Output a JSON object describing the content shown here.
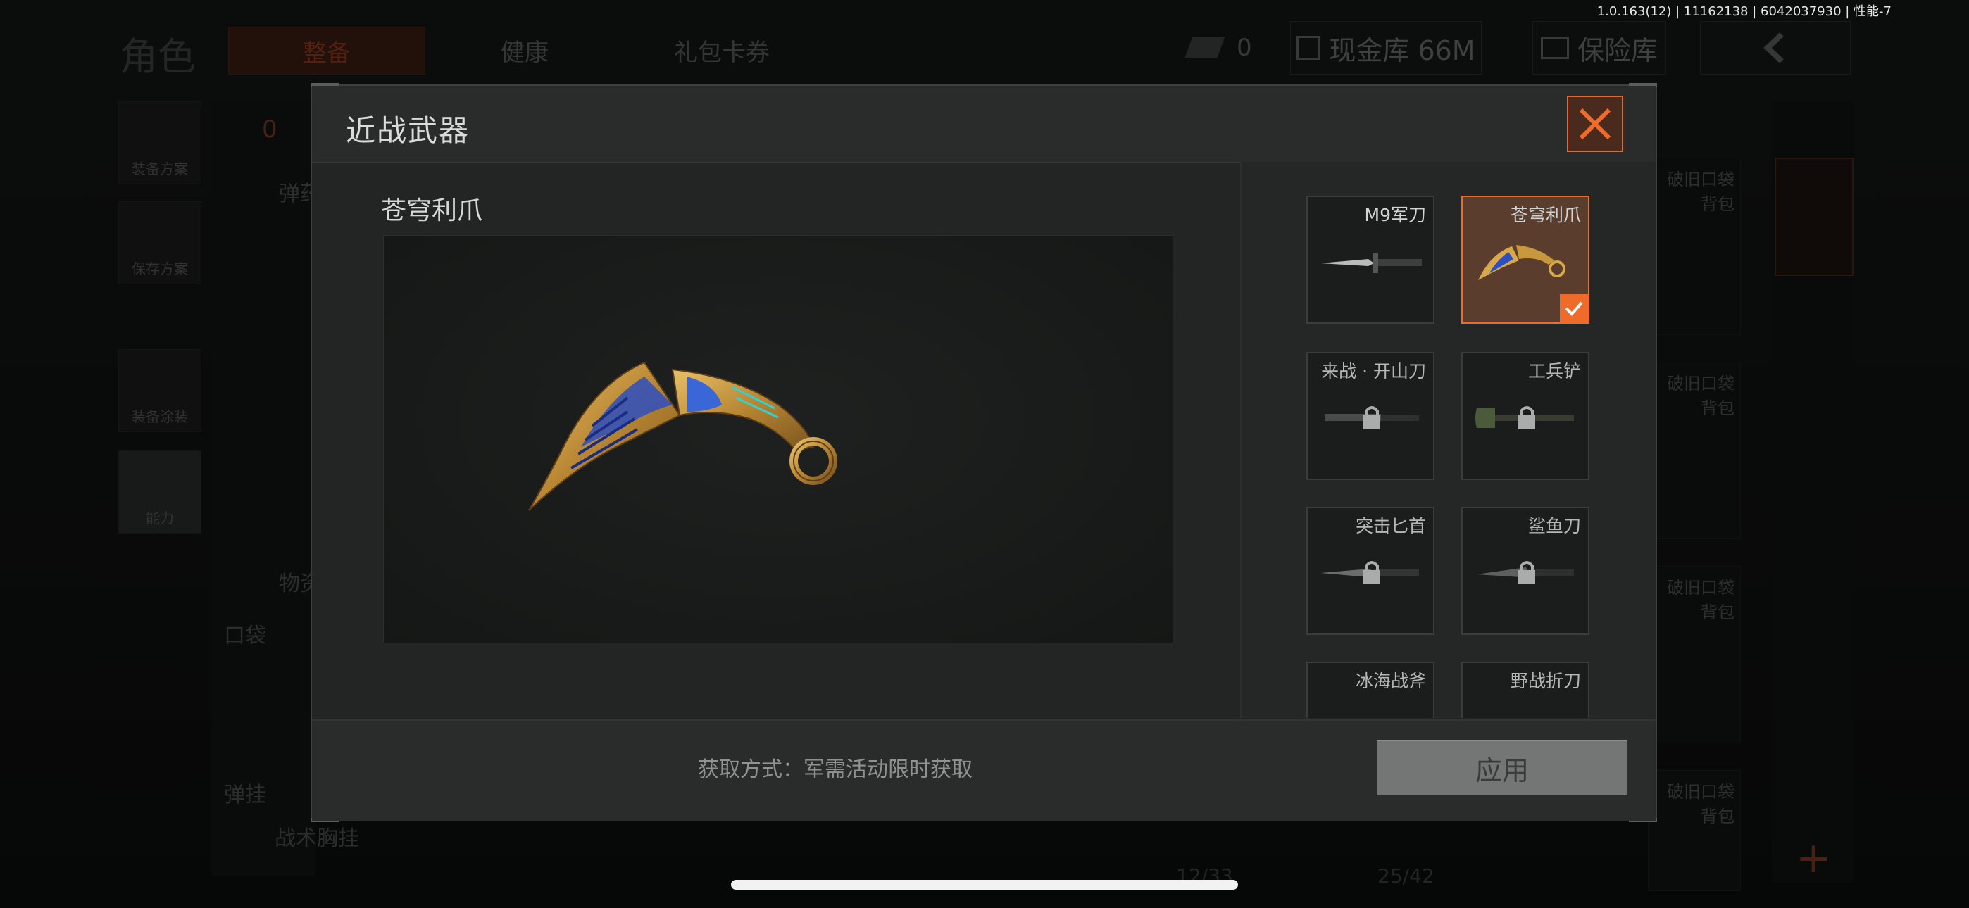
{
  "status_bar": {
    "version": "1.0.163(12) | 11162138 | 6042037930 | 性能-7"
  },
  "background": {
    "page_title": "角色",
    "tabs": [
      "整备",
      "健康",
      "礼包卡券"
    ],
    "currency_value": "0",
    "cash_vault": "现金库 66M",
    "safe": "保险库",
    "side_buttons": [
      "装备方案",
      "保存方案",
      "装备涂装",
      "能力"
    ],
    "left_labels": {
      "count": "0",
      "ammo": "弹药",
      "supplies": "物资",
      "pocket": "口袋",
      "hang": "弹挂",
      "chest_rig": "战术胸挂"
    },
    "bag_labels": [
      "破旧口袋背包",
      "破旧口袋背包",
      "破旧口袋背包",
      "破旧口袋背包"
    ],
    "counts": [
      "12/33",
      "25/42"
    ],
    "add_symbol": "+"
  },
  "modal": {
    "title": "近战武器",
    "selected_name": "苍穹利爪",
    "acquire_text": "获取方式：军需活动限时获取",
    "apply_label": "应用",
    "items": [
      {
        "name": "M9军刀",
        "locked": false,
        "selected": false
      },
      {
        "name": "苍穹利爪",
        "locked": false,
        "selected": true
      },
      {
        "name": "来战 · 开山刀",
        "locked": true,
        "selected": false
      },
      {
        "name": "工兵铲",
        "locked": true,
        "selected": false
      },
      {
        "name": "突击匕首",
        "locked": true,
        "selected": false
      },
      {
        "name": "鲨鱼刀",
        "locked": true,
        "selected": false
      },
      {
        "name": "冰海战斧",
        "locked": true,
        "selected": false
      },
      {
        "name": "野战折刀",
        "locked": true,
        "selected": false
      }
    ]
  },
  "colors": {
    "accent": "#f06a2a",
    "selected_bg": "#5a3d2c",
    "modal_bg": "#232524"
  }
}
